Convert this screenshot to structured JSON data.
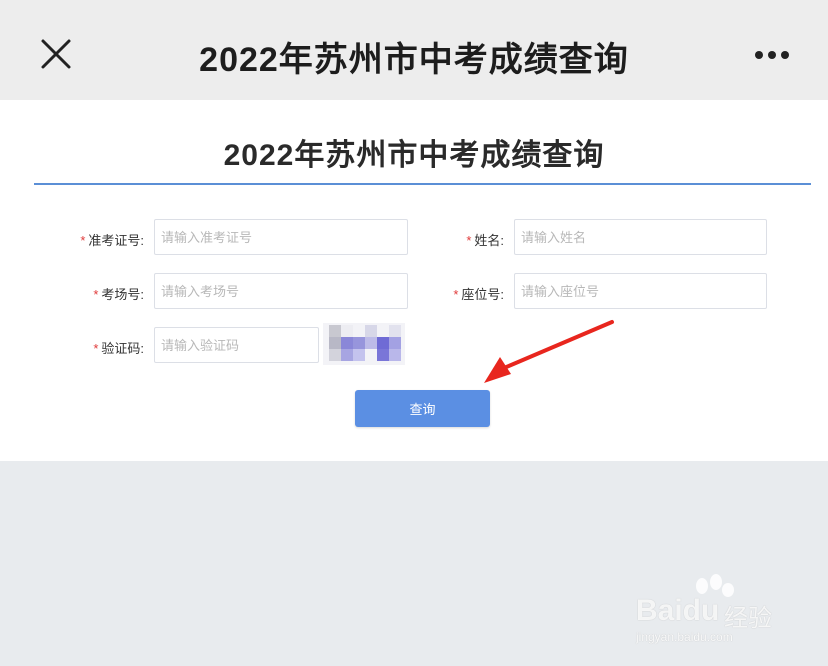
{
  "topbar": {
    "title": "2022年苏州市中考成绩查询",
    "close_icon": "close-icon",
    "more_icon": "more-dots-icon"
  },
  "page": {
    "title": "2022年苏州市中考成绩查询",
    "accent_color": "#5b8fd6"
  },
  "form": {
    "required_mark": "*",
    "admission_no": {
      "label": "准考证号:",
      "placeholder": "请输入准考证号",
      "value": ""
    },
    "name": {
      "label": "姓名:",
      "placeholder": "请输入姓名",
      "value": ""
    },
    "exam_room": {
      "label": "考场号:",
      "placeholder": "请输入考场号",
      "value": ""
    },
    "seat_no": {
      "label": "座位号:",
      "placeholder": "请输入座位号",
      "value": ""
    },
    "captcha": {
      "label": "验证码:",
      "placeholder": "请输入验证码",
      "value": ""
    },
    "submit_label": "查询",
    "button_color": "#5b8fe3"
  },
  "watermark": {
    "brand": "Baidu",
    "sub": "经验",
    "url": "jingyan.baidu.com"
  }
}
